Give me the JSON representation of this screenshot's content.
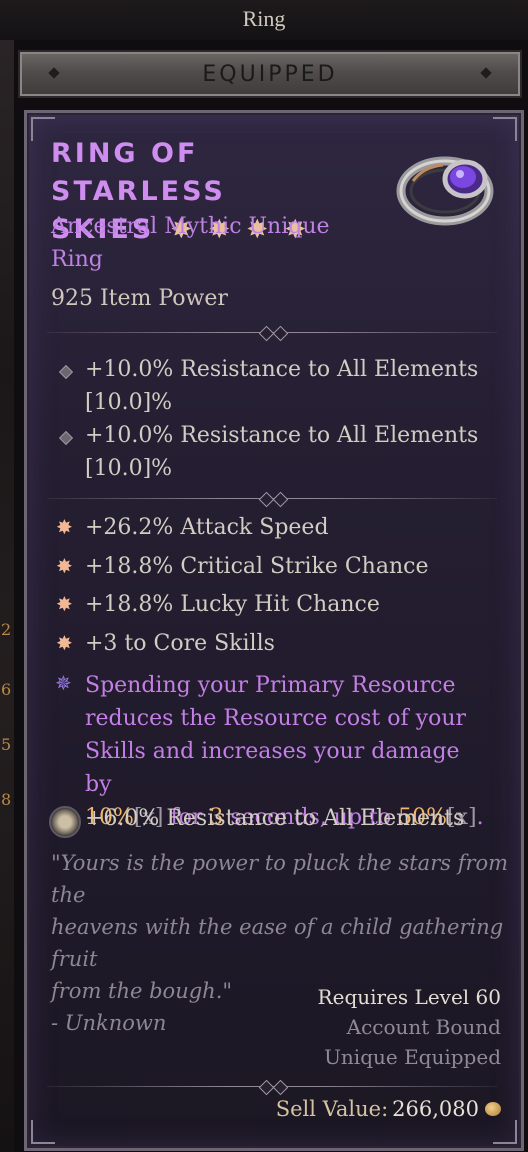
{
  "window": {
    "title": "Ring"
  },
  "equipped_bar": {
    "label": "EQUIPPED"
  },
  "item": {
    "name_line1": "RING OF STARLESS",
    "name_line2": "SKIES",
    "rarity_line1": "Ancestral Mythic Unique",
    "rarity_line2": "Ring",
    "item_power": "925 Item Power",
    "name_color": "#cf8df0",
    "rarity_color": "#bf82e4",
    "implicit_stats": [
      {
        "text": "+10.0% Resistance to All Elements",
        "range": "[10.0]%"
      },
      {
        "text": "+10.0% Resistance to All Elements",
        "range": "[10.0]%"
      }
    ],
    "affixes": [
      "+26.2% Attack Speed",
      "+18.8% Critical Strike Chance",
      "+18.8% Lucky Hit Chance",
      "+3 to Core Skills"
    ],
    "unique_power": {
      "line1": "Spending your Primary Resource",
      "line2": "reduces the Resource cost of your",
      "line3": "Skills and increases your damage by",
      "value1": "10%",
      "bracket1": "[x]",
      "mid": " for ",
      "value2": "3",
      "mid2": " seconds, up to ",
      "value3": "50%",
      "bracket2": "[x]",
      "end": ".",
      "highlight_color": "#f2b66a"
    },
    "socket_stat": "+6.0% Resistance to All Elements",
    "flavor_line1": "\"Yours is the power to pluck the stars from the",
    "flavor_line2": "heavens with the ease of a child gathering fruit",
    "flavor_line3": "from the bough.\"",
    "flavor_author": "- Unknown",
    "requires_level": "Requires Level 60",
    "account_bound": "Account Bound",
    "unique_equipped": "Unique Equipped",
    "sell_label": "Sell Value:",
    "sell_value": "266,080",
    "icons": {
      "ring": "ring-icon",
      "greater_affix": "greater-affix-star-icon",
      "unique_power": "unique-power-icon",
      "implicit": "diamond-bullet-icon",
      "socket": "gem-socket-icon",
      "gold": "gold-coin-icon"
    }
  }
}
